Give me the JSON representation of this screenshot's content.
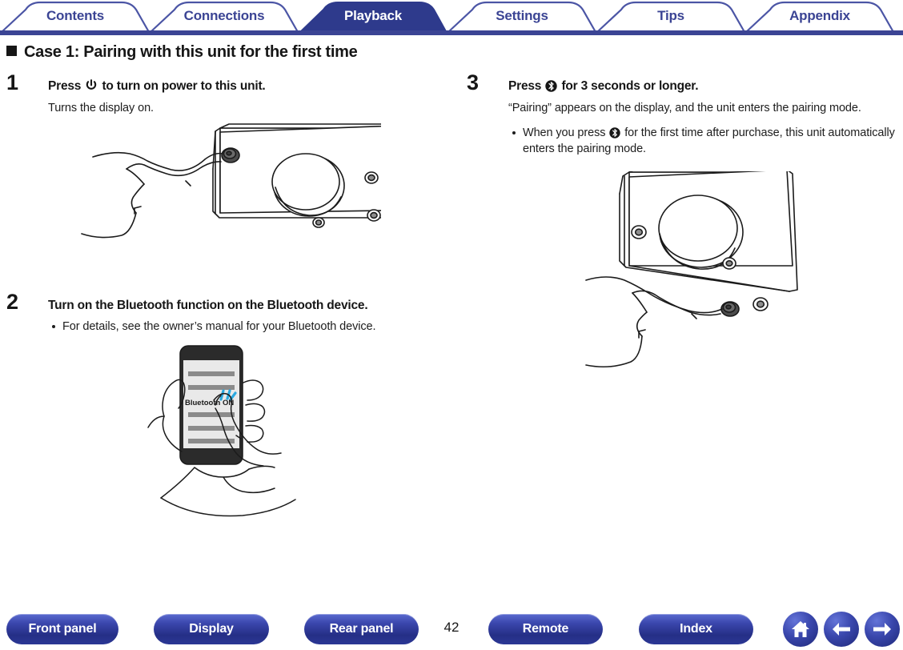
{
  "tabs": [
    {
      "label": "Contents",
      "active": false
    },
    {
      "label": "Connections",
      "active": false
    },
    {
      "label": "Playback",
      "active": true
    },
    {
      "label": "Settings",
      "active": false
    },
    {
      "label": "Tips",
      "active": false
    },
    {
      "label": "Appendix",
      "active": false
    }
  ],
  "section": {
    "bullet_icon": "black-square-bullet",
    "title": "Case 1: Pairing with this unit for the first time"
  },
  "steps": [
    {
      "number": "1",
      "heading_before": "Press ",
      "heading_icon": "power-icon",
      "heading_after": " to turn on power to this unit.",
      "sub": "Turns the display on.",
      "bullets": [],
      "figure": "hand-pressing-power-button-on-front-panel"
    },
    {
      "number": "2",
      "heading_before": "Turn on the Bluetooth function on the Bluetooth device.",
      "heading_icon": "",
      "heading_after": "",
      "sub": "",
      "bullets": [
        {
          "before": "For details, see the owner’s manual for your Bluetooth device.",
          "icon": "",
          "after": ""
        }
      ],
      "figure": "hand-tapping-bluetooth-on-smartphone",
      "figure_caption": "Bluetooth ON"
    },
    {
      "number": "3",
      "heading_before": "Press ",
      "heading_icon": "bluetooth-icon",
      "heading_after": " for 3 seconds or longer.",
      "sub": "“Pairing” appears on the display, and the unit enters the pairing mode.",
      "bullets": [
        {
          "before": "When you press ",
          "icon": "bluetooth-icon",
          "after": " for the first time after purchase, this unit automatically enters the pairing mode."
        }
      ],
      "figure": "hand-pressing-bluetooth-button-on-front-panel"
    }
  ],
  "bottom_nav": {
    "buttons": [
      {
        "label": "Front panel"
      },
      {
        "label": "Display"
      },
      {
        "label": "Rear panel"
      },
      {
        "label": "Remote"
      },
      {
        "label": "Index"
      }
    ],
    "page_number": "42",
    "icons": [
      {
        "name": "home-icon"
      },
      {
        "name": "arrow-left-icon"
      },
      {
        "name": "arrow-right-icon"
      }
    ]
  },
  "colors": {
    "brand_blue": "#3b4494",
    "active_tab": "#2e3a8c",
    "tab_text": "#3b4494",
    "text": "#161616",
    "tap_highlight": "#29a8e0"
  }
}
